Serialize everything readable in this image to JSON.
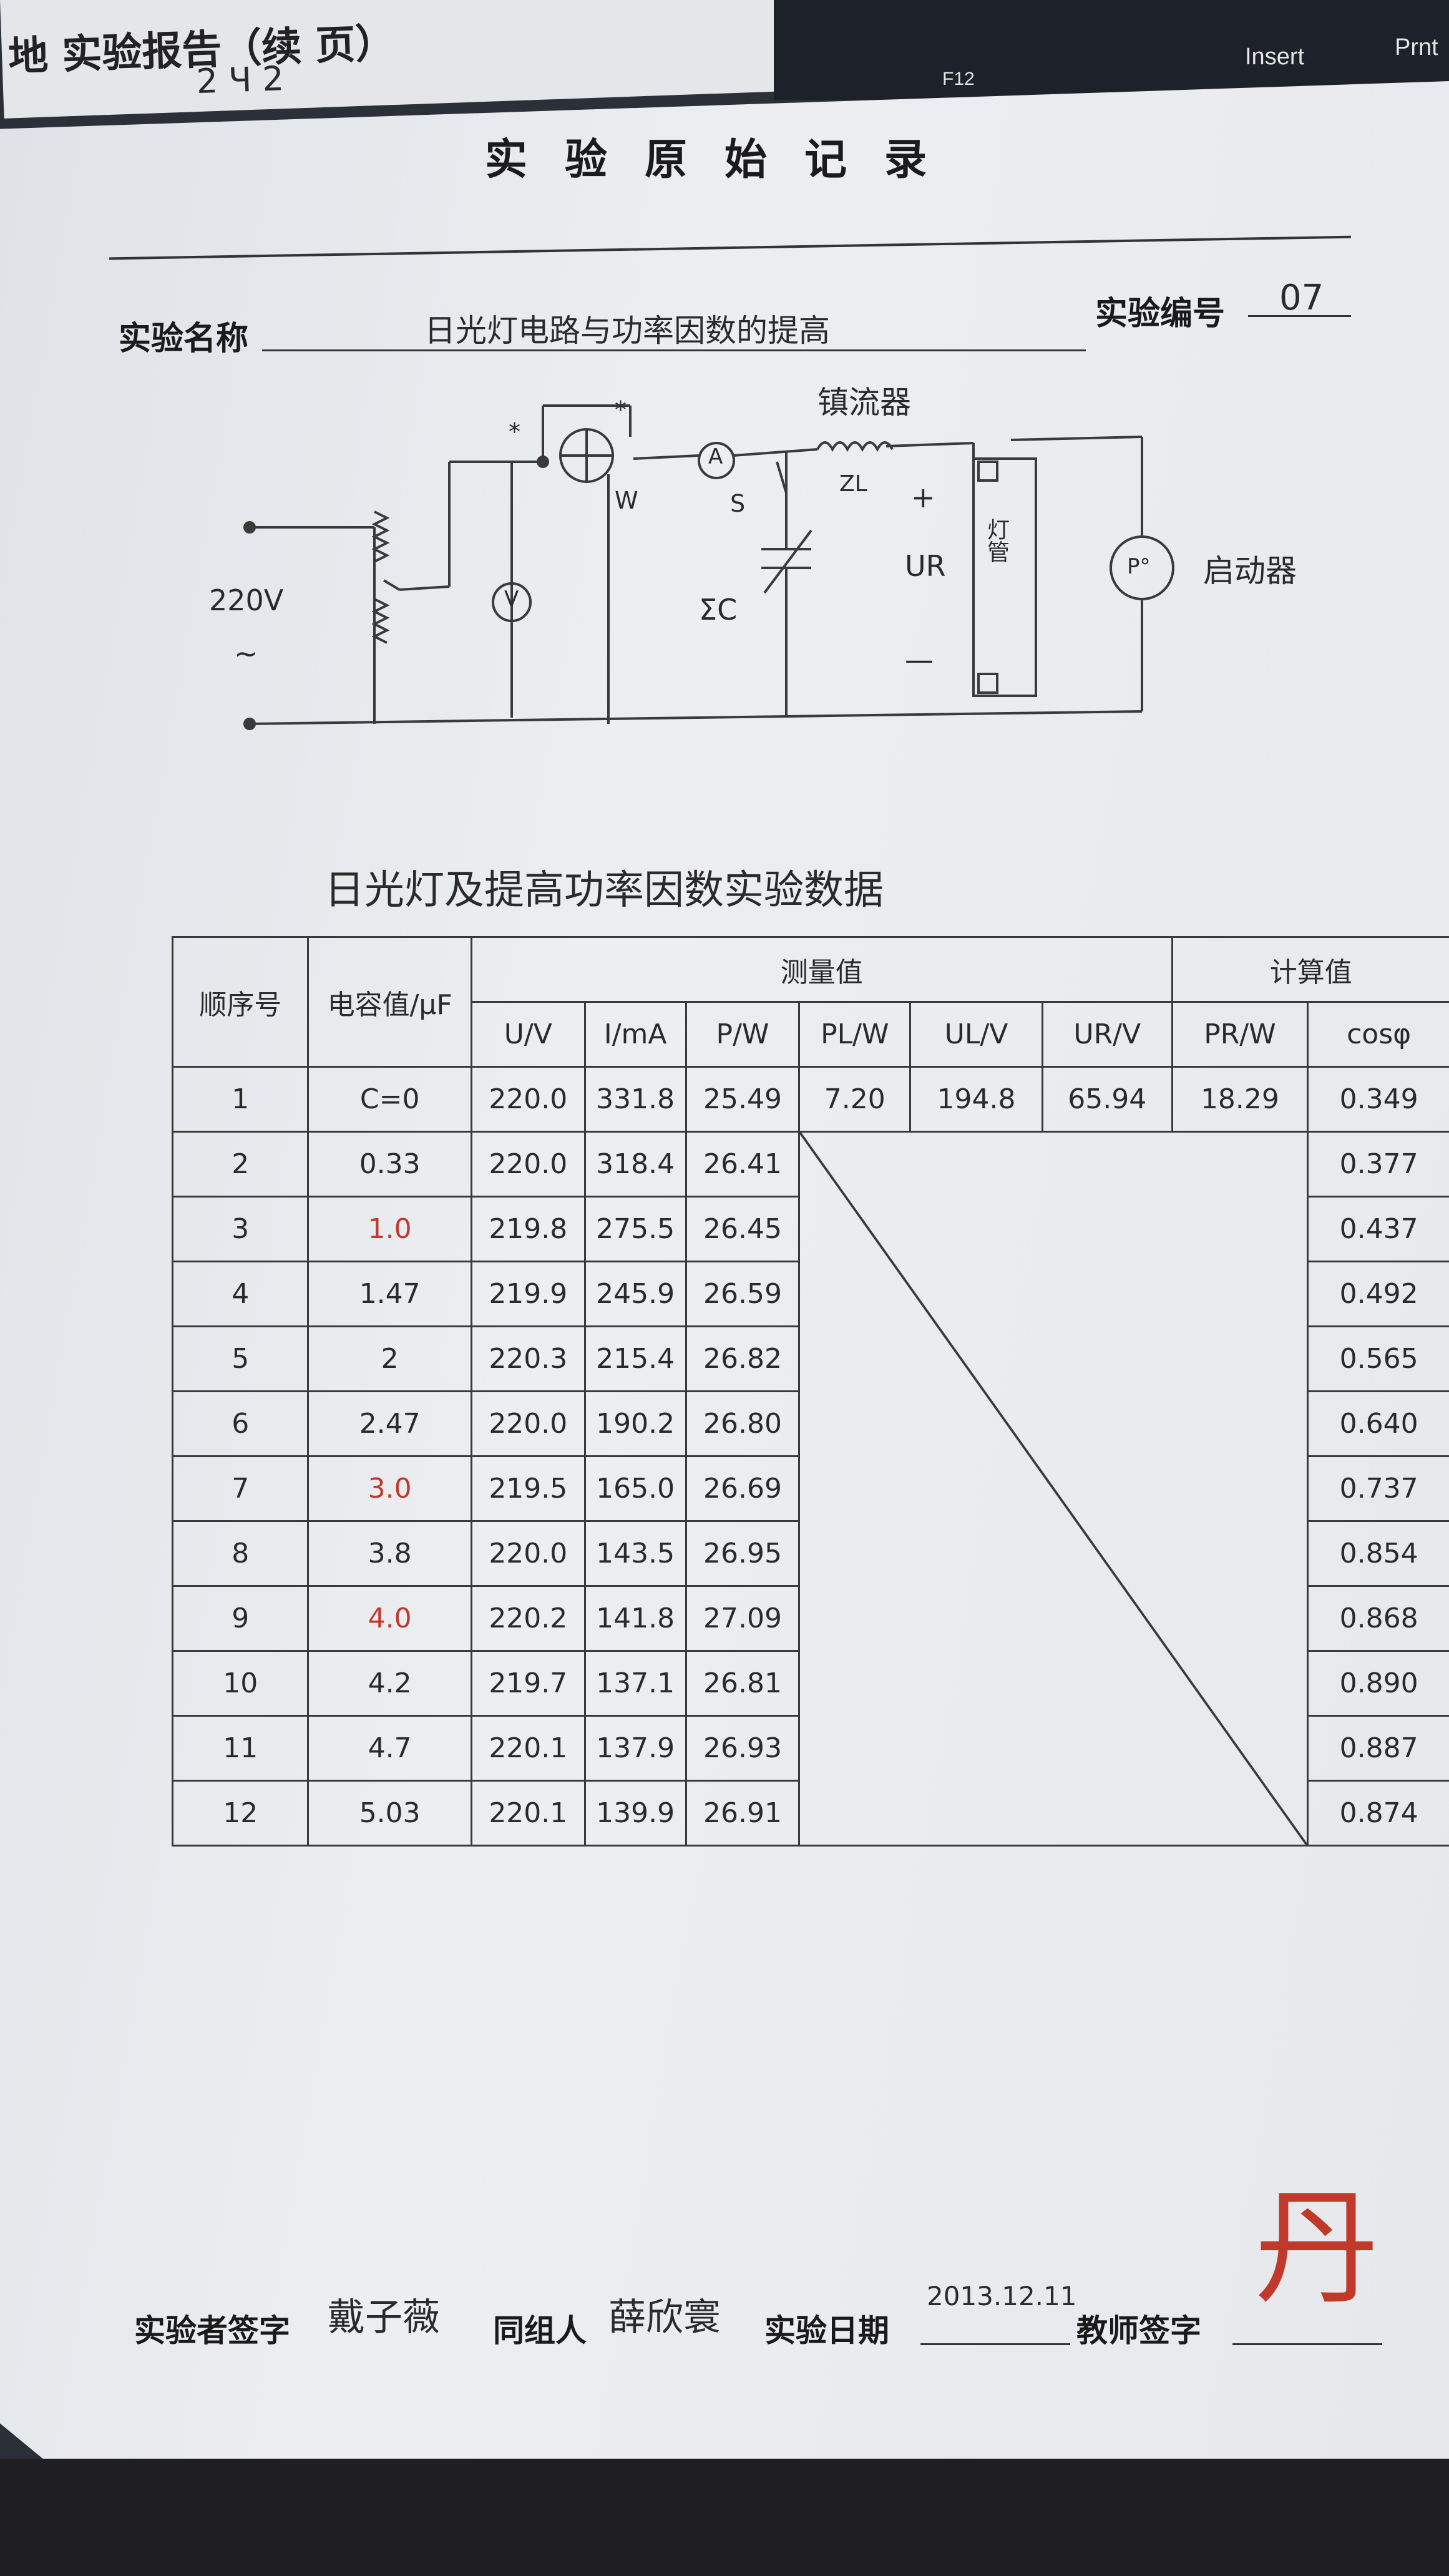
{
  "background": {
    "prev_page_header": "地 实验报告（续 页）",
    "prev_page_digits": "2 Ч 2",
    "keyboard_keys": [
      "F12",
      "Insert",
      "Prnt"
    ]
  },
  "header": {
    "title": "实验原始记录",
    "name_label": "实验名称",
    "name_value": "日光灯电路与功率因数的提高",
    "number_label": "实验编号",
    "number_value": "07"
  },
  "circuit": {
    "source_label": "220V",
    "source_symbol": "~",
    "ballast_label": "镇流器",
    "starter_label": "启动器",
    "lamp_label": "灯管",
    "wattmeter_label": "W",
    "ammeter_label": "A",
    "voltmeter_label": "V",
    "switch_label": "S",
    "capacitor_label": "ΣC",
    "zl_label": "ZL",
    "ur_label": "UR",
    "plus_sign": "+",
    "minus_sign": "—",
    "star_mark": "*",
    "starter_symbol": "P°"
  },
  "table": {
    "title": "日光灯及提高功率因数实验数据",
    "col_seq": "顺序号",
    "col_cap": "电容值/μF",
    "group_measured": "测量值",
    "group_calculated": "计算值",
    "measured_headers": [
      "U/V",
      "I/mA",
      "P/W",
      "PL/W",
      "UL/V",
      "UR/V"
    ],
    "calculated_headers": [
      "PR/W",
      "cosφ"
    ],
    "rows": [
      {
        "seq": "1",
        "cap": "C=0",
        "u": "220.0",
        "i": "331.8",
        "p": "25.49",
        "pl": "7.20",
        "ul": "194.8",
        "ur": "65.94",
        "pr": "18.29",
        "cos": "0.349"
      },
      {
        "seq": "2",
        "cap": "0.33",
        "u": "220.0",
        "i": "318.4",
        "p": "26.41",
        "cos": "0.377"
      },
      {
        "seq": "3",
        "cap": "1.0",
        "u": "219.8",
        "i": "275.5",
        "p": "26.45",
        "cos": "0.437"
      },
      {
        "seq": "4",
        "cap": "1.47",
        "u": "219.9",
        "i": "245.9",
        "p": "26.59",
        "cos": "0.492"
      },
      {
        "seq": "5",
        "cap": "2",
        "u": "220.3",
        "i": "215.4",
        "p": "26.82",
        "cos": "0.565"
      },
      {
        "seq": "6",
        "cap": "2.47",
        "u": "220.0",
        "i": "190.2",
        "p": "26.80",
        "cos": "0.640"
      },
      {
        "seq": "7",
        "cap": "3.0",
        "u": "219.5",
        "i": "165.0",
        "p": "26.69",
        "cos": "0.737"
      },
      {
        "seq": "8",
        "cap": "3.8",
        "u": "220.0",
        "i": "143.5",
        "p": "26.95",
        "cos": "0.854"
      },
      {
        "seq": "9",
        "cap": "4.0",
        "u": "220.2",
        "i": "141.8",
        "p": "27.09",
        "cos": "0.868"
      },
      {
        "seq": "10",
        "cap": "4.2",
        "u": "219.7",
        "i": "137.1",
        "p": "26.81",
        "cos": "0.890"
      },
      {
        "seq": "11",
        "cap": "4.7",
        "u": "220.1",
        "i": "137.9",
        "p": "26.93",
        "cos": "0.887"
      },
      {
        "seq": "12",
        "cap": "5.03",
        "u": "220.1",
        "i": "139.9",
        "p": "26.91",
        "cos": "0.874"
      }
    ]
  },
  "footer": {
    "experimenter_label": "实验者签字",
    "experimenter_value": "戴子薇",
    "partner_label": "同组人",
    "partner_value": "薛欣寰",
    "date_label": "实验日期",
    "date_value": "2013.12.11",
    "teacher_label": "教师签字",
    "teacher_value": "丹",
    "teacher_sign_color": "#c0392b"
  }
}
